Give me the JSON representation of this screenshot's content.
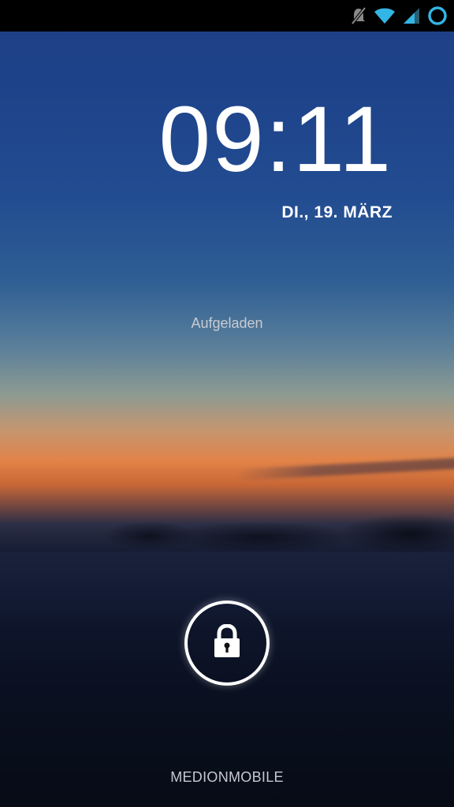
{
  "status_bar": {
    "icons": [
      "mute-vibrate-icon",
      "wifi-icon",
      "signal-icon",
      "sync-ring-icon"
    ],
    "accent_color": "#33b5e5"
  },
  "lockscreen": {
    "time": "09:11",
    "date": "DI., 19. MÄRZ",
    "charge_status": "Aufgeladen",
    "unlock_icon": "lock-icon",
    "carrier": "MEDIONMOBILE"
  }
}
